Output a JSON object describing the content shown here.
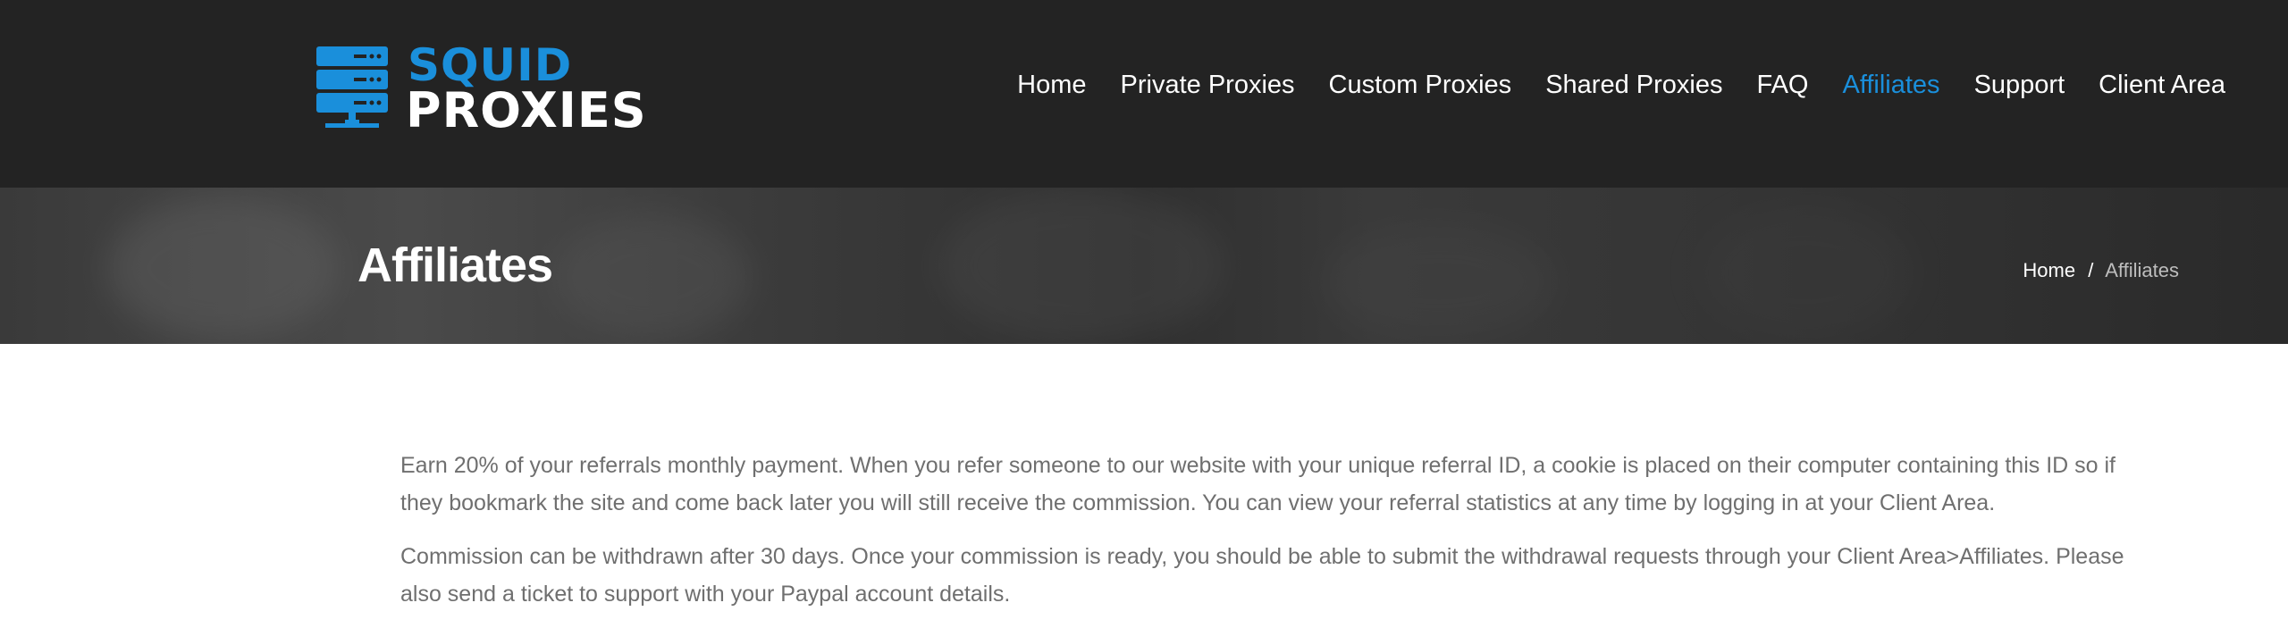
{
  "logo": {
    "line1": "SQUID",
    "line2": "PROXIES",
    "icon": "server-stack-icon",
    "brand_color": "#1a8fdb"
  },
  "nav": {
    "items": [
      {
        "label": "Home",
        "active": false
      },
      {
        "label": "Private Proxies",
        "active": false
      },
      {
        "label": "Custom Proxies",
        "active": false
      },
      {
        "label": "Shared Proxies",
        "active": false
      },
      {
        "label": "FAQ",
        "active": false
      },
      {
        "label": "Affiliates",
        "active": true
      },
      {
        "label": "Support",
        "active": false
      },
      {
        "label": "Client Area",
        "active": false
      }
    ]
  },
  "banner": {
    "title": "Affiliates",
    "breadcrumb": {
      "home": "Home",
      "separator": "/",
      "current": "Affiliates"
    }
  },
  "content": {
    "paragraphs": [
      "Earn 20% of your referrals monthly payment. When you refer someone to our website with your unique referral ID, a cookie is placed on their computer containing this ID so if they bookmark the site and come back later you will still receive the commission. You can view your referral statistics at any time by logging in at your Client Area.",
      "Commission can be withdrawn after 30 days. Once your commission is ready, you should be able to submit the withdrawal requests through your Client Area>Affiliates. Please also send a ticket to support with your Paypal account details."
    ]
  },
  "colors": {
    "header_bg": "#232323",
    "accent": "#1a8fdb",
    "body_text": "#6f6f6f"
  }
}
